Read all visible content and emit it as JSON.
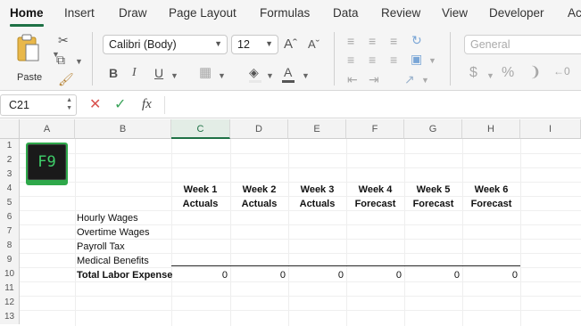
{
  "tabs": [
    "Home",
    "Insert",
    "Draw",
    "Page Layout",
    "Formulas",
    "Data",
    "Review",
    "View",
    "Developer",
    "Ac"
  ],
  "ribbon": {
    "paste_label": "Paste",
    "font_name": "Calibri (Body)",
    "font_size": "12",
    "number_format": "General",
    "accent_color": "#1e7145"
  },
  "formula_bar": {
    "name_box": "C21",
    "fx_label": "fx",
    "formula": ""
  },
  "sheet": {
    "columns": [
      "A",
      "B",
      "C",
      "D",
      "E",
      "F",
      "G",
      "H",
      "I"
    ],
    "selected_column": "C",
    "rows": [
      "1",
      "2",
      "3",
      "4",
      "5",
      "6",
      "7",
      "8",
      "9",
      "10",
      "11",
      "12",
      "13"
    ],
    "logo_text": "F9",
    "week_headers": [
      {
        "line1": "Week 1",
        "line2": "Actuals"
      },
      {
        "line1": "Week 2",
        "line2": "Actuals"
      },
      {
        "line1": "Week 3",
        "line2": "Actuals"
      },
      {
        "line1": "Week 4",
        "line2": "Forecast"
      },
      {
        "line1": "Week 5",
        "line2": "Forecast"
      },
      {
        "line1": "Week 6",
        "line2": "Forecast"
      }
    ],
    "row_labels": [
      "Hourly Wages",
      "Overtime Wages",
      "Payroll Tax",
      "Medical Benefits"
    ],
    "total_label": "Total Labor Expense",
    "totals": [
      "0",
      "0",
      "0",
      "0",
      "0",
      "0"
    ]
  }
}
